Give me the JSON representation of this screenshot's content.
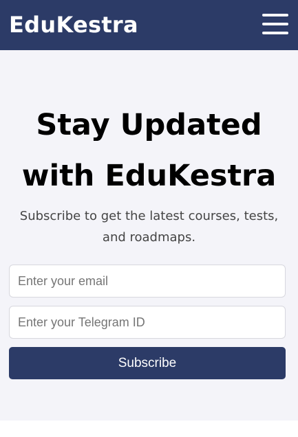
{
  "header": {
    "brand": "EduKestra",
    "menu_icon": "hamburger-menu-icon"
  },
  "subscribe_section": {
    "heading_line1": "Stay Updated",
    "heading_line2": "with EduKestra",
    "subtitle": "Subscribe to get the latest courses, tests, and roadmaps.",
    "email_placeholder": "Enter your email",
    "telegram_placeholder": "Enter your Telegram ID",
    "button_label": "Subscribe"
  },
  "colors": {
    "navbar": "#2c3b67",
    "section_background": "#f4f4f9",
    "button": "#2c3b67"
  }
}
